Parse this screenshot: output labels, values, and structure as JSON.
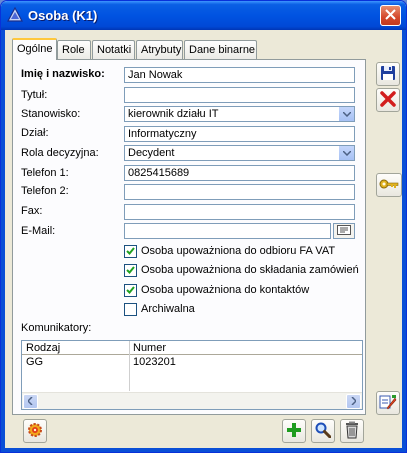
{
  "window": {
    "title": "Osoba  (K1)"
  },
  "tabs": [
    {
      "label": "Ogólne"
    },
    {
      "label": "Role"
    },
    {
      "label": "Notatki"
    },
    {
      "label": "Atrybuty"
    },
    {
      "label": "Dane binarne"
    }
  ],
  "form": {
    "name_label": "Imię i nazwisko:",
    "name_value": "Jan Nowak",
    "title_label": "Tytuł:",
    "title_value": "",
    "position_label": "Stanowisko:",
    "position_value": "kierownik działu IT",
    "department_label": "Dział:",
    "department_value": "Informatyczny",
    "role_label": "Rola decyzyjna:",
    "role_value": "Decydent",
    "phone1_label": "Telefon 1:",
    "phone1_value": "0825415689",
    "phone2_label": "Telefon 2:",
    "phone2_value": "",
    "fax_label": "Fax:",
    "fax_value": "",
    "email_label": "E-Mail:",
    "email_value": ""
  },
  "checkboxes": [
    {
      "label": "Osoba upoważniona do odbioru FA VAT",
      "checked": true
    },
    {
      "label": "Osoba upoważniona do składania zamówień",
      "checked": true
    },
    {
      "label": "Osoba upoważniona do kontaktów",
      "checked": true
    },
    {
      "label": "Archiwalna",
      "checked": false
    }
  ],
  "communicators": {
    "label": "Komunikatory:",
    "columns": [
      "Rodzaj",
      "Numer"
    ],
    "rows": [
      [
        "GG",
        "1023201"
      ]
    ]
  },
  "icons": {
    "title": "triangle-icon",
    "close": "close-icon",
    "save": "save-icon",
    "cancel": "cancel-icon",
    "keys": "keys-icon",
    "edit": "edit-icon",
    "settings": "gear-icon",
    "add": "plus-icon",
    "search": "magnifier-icon",
    "delete": "trash-icon"
  },
  "colors": {
    "titlebar": "#0053e1",
    "accent_tab": "#ffc83c",
    "check": "#21a121"
  }
}
